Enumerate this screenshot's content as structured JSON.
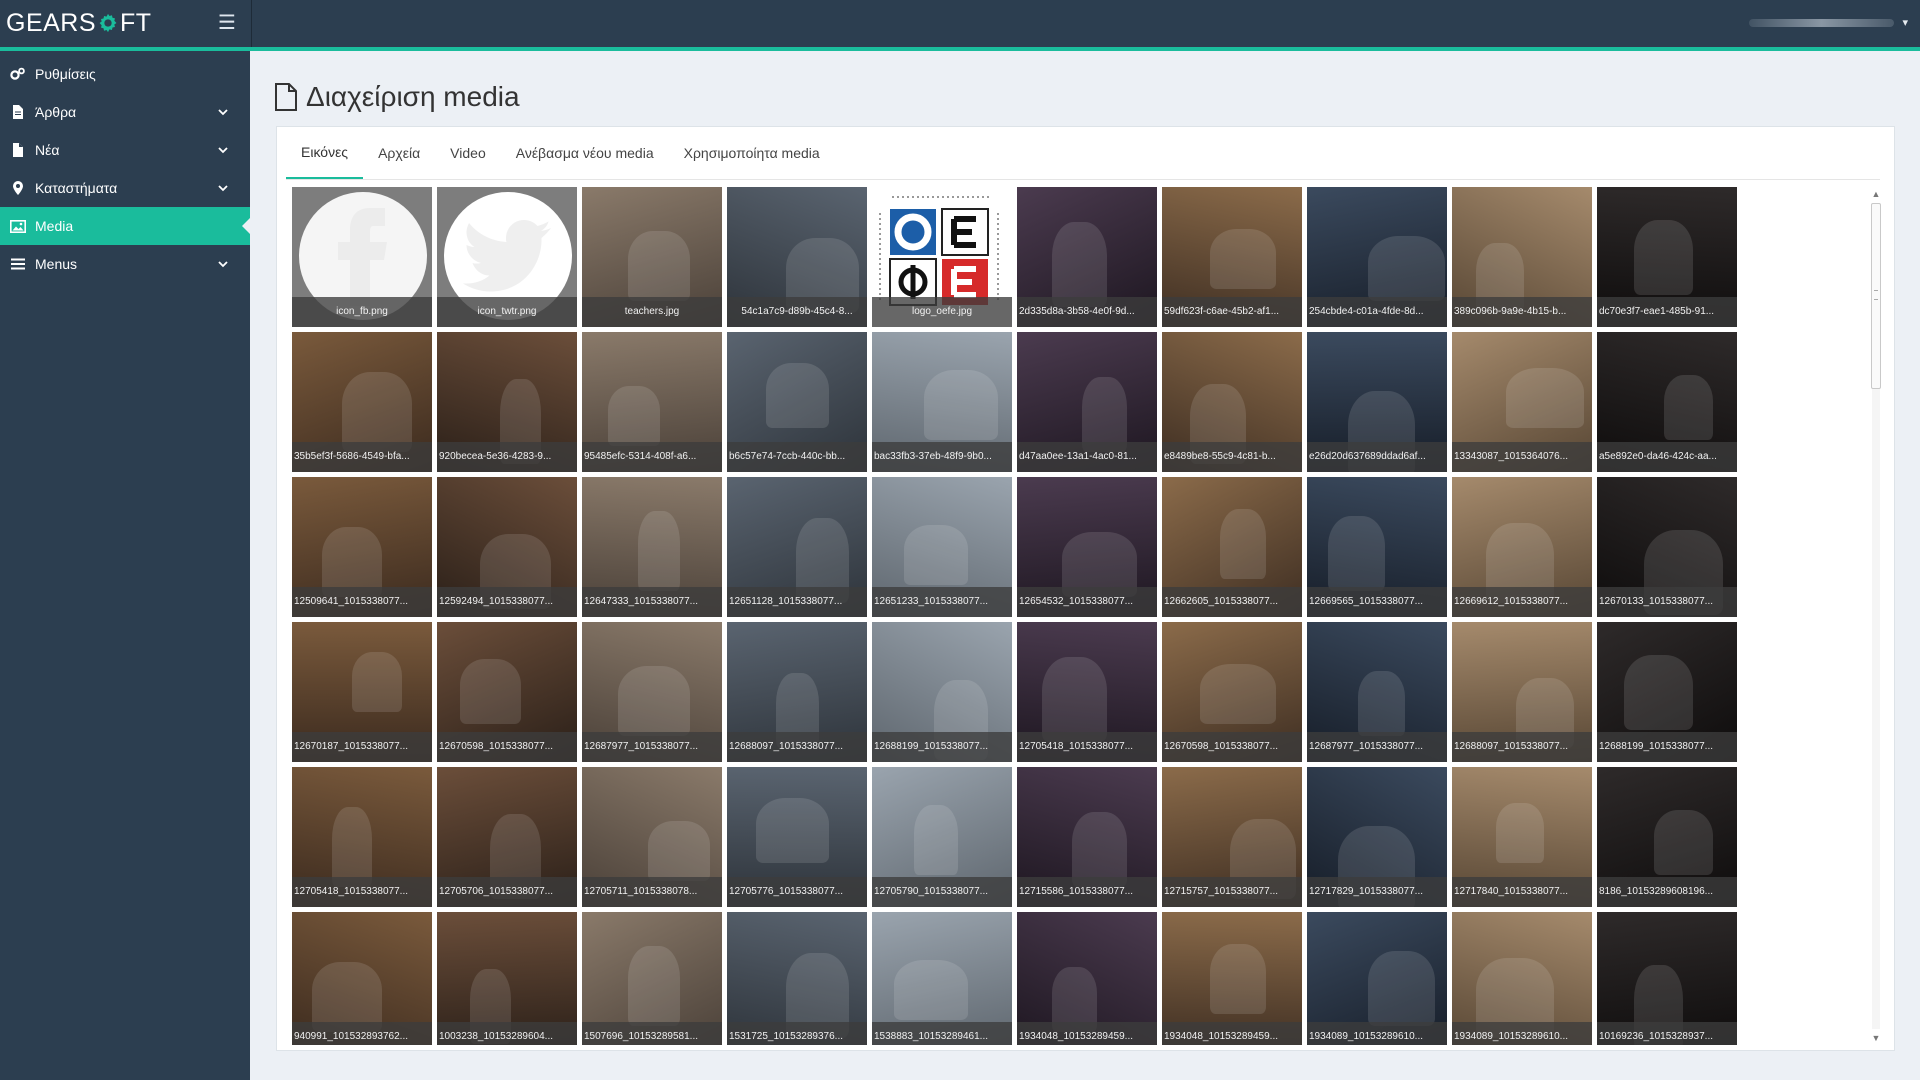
{
  "brand": {
    "name_pre": "GEARS",
    "name_post": "FT",
    "accent": "#1abc9c",
    "dark": "#2c3e50"
  },
  "topbar": {
    "menu_icon": "hamburger-icon",
    "user_caret": "▾"
  },
  "sidebar": {
    "items": [
      {
        "label": "Ρυθμίσεις",
        "icon": "gears-icon",
        "expandable": false,
        "active": false
      },
      {
        "label": "Άρθρα",
        "icon": "document-icon",
        "expandable": true,
        "active": false
      },
      {
        "label": "Νέα",
        "icon": "document-icon",
        "expandable": true,
        "active": false
      },
      {
        "label": "Καταστήματα",
        "icon": "map-marker-icon",
        "expandable": true,
        "active": false
      },
      {
        "label": "Media",
        "icon": "image-icon",
        "expandable": false,
        "active": true
      },
      {
        "label": "Menus",
        "icon": "list-icon",
        "expandable": true,
        "active": false
      }
    ]
  },
  "page": {
    "title": "Διαχείριση media",
    "title_icon": "file-icon"
  },
  "tabs": [
    {
      "label": "Εικόνες",
      "active": true
    },
    {
      "label": "Αρχεία",
      "active": false
    },
    {
      "label": "Video",
      "active": false
    },
    {
      "label": "Ανέβασμα νέου media",
      "active": false
    },
    {
      "label": "Χρησιμοποίητα media",
      "active": false
    }
  ],
  "media": [
    {
      "name": "icon_fb.png"
    },
    {
      "name": "icon_twtr.png"
    },
    {
      "name": "teachers.jpg"
    },
    {
      "name": "54c1a7c9-d89b-45c4-8..."
    },
    {
      "name": "logo_oefe.jpg"
    },
    {
      "name": "2d335d8a-3b58-4e0f-9d..."
    },
    {
      "name": "59df623f-c6ae-45b2-af1..."
    },
    {
      "name": "254cbde4-c01a-4fde-8d..."
    },
    {
      "name": "389c096b-9a9e-4b15-b..."
    },
    {
      "name": "dc70e3f7-eae1-485b-91..."
    },
    {
      "name": "35b5ef3f-5686-4549-bfa..."
    },
    {
      "name": "920becea-5e36-4283-9..."
    },
    {
      "name": "95485efc-5314-408f-a6..."
    },
    {
      "name": "b6c57e74-7ccb-440c-bb..."
    },
    {
      "name": "bac33fb3-37eb-48f9-9b0..."
    },
    {
      "name": "d47aa0ee-13a1-4ac0-81..."
    },
    {
      "name": "e8489be8-55c9-4c81-b..."
    },
    {
      "name": "e26d20d637689ddad6af..."
    },
    {
      "name": "13343087_1015364076..."
    },
    {
      "name": "a5e892e0-da46-424c-aa..."
    },
    {
      "name": "12509641_1015338077..."
    },
    {
      "name": "12592494_1015338077..."
    },
    {
      "name": "12647333_1015338077..."
    },
    {
      "name": "12651128_1015338077..."
    },
    {
      "name": "12651233_1015338077..."
    },
    {
      "name": "12654532_1015338077..."
    },
    {
      "name": "12662605_1015338077..."
    },
    {
      "name": "12669565_1015338077..."
    },
    {
      "name": "12669612_1015338077..."
    },
    {
      "name": "12670133_1015338077..."
    },
    {
      "name": "12670187_1015338077..."
    },
    {
      "name": "12670598_1015338077..."
    },
    {
      "name": "12687977_1015338077..."
    },
    {
      "name": "12688097_1015338077..."
    },
    {
      "name": "12688199_1015338077..."
    },
    {
      "name": "12705418_1015338077..."
    },
    {
      "name": "12670598_1015338077..."
    },
    {
      "name": "12687977_1015338077..."
    },
    {
      "name": "12688097_1015338077..."
    },
    {
      "name": "12688199_1015338077..."
    },
    {
      "name": "12705418_1015338077..."
    },
    {
      "name": "12705706_1015338077..."
    },
    {
      "name": "12705711_1015338078..."
    },
    {
      "name": "12705776_1015338077..."
    },
    {
      "name": "12705790_1015338077..."
    },
    {
      "name": "12715586_1015338077..."
    },
    {
      "name": "12715757_1015338077..."
    },
    {
      "name": "12717829_1015338077..."
    },
    {
      "name": "12717840_1015338077..."
    },
    {
      "name": "8186_10153289608196..."
    },
    {
      "name": "940991_101532893762..."
    },
    {
      "name": "1003238_10153289604..."
    },
    {
      "name": "1507696_10153289581..."
    },
    {
      "name": "1531725_10153289376..."
    },
    {
      "name": "1538883_10153289461..."
    },
    {
      "name": "1934048_10153289459..."
    },
    {
      "name": "1934048_10153289459..."
    },
    {
      "name": "1934089_10153289610..."
    },
    {
      "name": "1934089_10153289610..."
    },
    {
      "name": "10169236_1015328937..."
    }
  ],
  "scrollbar": {
    "up": "▲",
    "down": "▼"
  }
}
